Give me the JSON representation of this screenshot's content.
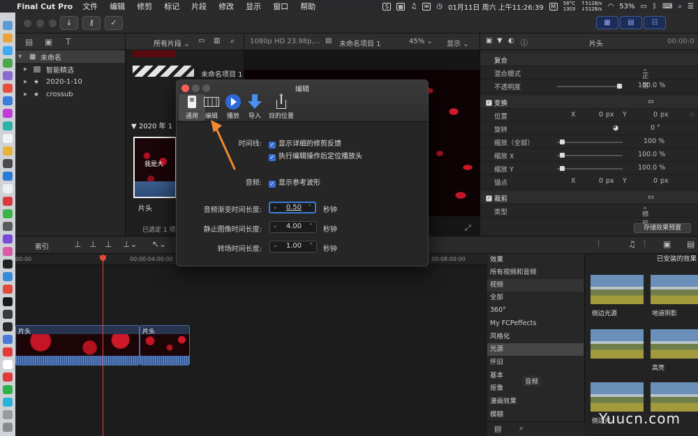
{
  "menubar": {
    "app": "Final Cut Pro",
    "items": [
      "文件",
      "编辑",
      "修剪",
      "标记",
      "片段",
      "修改",
      "显示",
      "窗口",
      "帮助"
    ],
    "temp": "58°C",
    "fan": "1303",
    "net_up": "↑512B/s",
    "net_down": "↓512B/s",
    "datetime": "01月11日 周六 上午11:26:39",
    "battery": "53%"
  },
  "library": {
    "items": [
      {
        "label": "未命名"
      },
      {
        "label": "智能精选"
      },
      {
        "label": "2020-1-10"
      },
      {
        "label": "crossub"
      }
    ]
  },
  "browser": {
    "filter": "所有片段",
    "project_name": "未命名项目 1",
    "date_group": "2020 年 1",
    "clip_name": "片头",
    "clip_overlay_text": "我是大",
    "selection_status": "已选定 1 项"
  },
  "viewer": {
    "format": "1080p HD 23.98p,...",
    "project": "未命名项目 1",
    "zoom": "45%",
    "display": "显示"
  },
  "inspector": {
    "title": "片头",
    "timecode": "00:00:0",
    "composite": {
      "section": "复合",
      "blend_label": "混合模式",
      "blend_value": "正常",
      "opacity_label": "不透明度",
      "opacity_value": "100.0 %"
    },
    "transform": {
      "section": "变换",
      "position_label": "位置",
      "x_label": "X",
      "x_value": "0",
      "px": "px",
      "y_label": "Y",
      "y_value": "0",
      "rotation_label": "旋转",
      "rotation_value": "0 °",
      "scale_all_label": "缩放（全部）",
      "scale_all_value": "100 %",
      "scale_x_label": "缩放 X",
      "scale_x_value": "100.0 %",
      "scale_y_label": "缩放 Y",
      "scale_y_value": "100.0 %",
      "anchor_label": "锚点",
      "anchor_x_value": "0",
      "anchor_y_value": "0"
    },
    "crop": {
      "section": "裁剪",
      "type_label": "类型",
      "type_value": "修剪"
    },
    "save_preset": "存储效果预置"
  },
  "timeline": {
    "index_label": "索引",
    "ruler": [
      "00:00",
      "00:00:04:00:00",
      "00:08:00:00"
    ],
    "clips": [
      {
        "label": "片头"
      },
      {
        "label": "片头"
      }
    ]
  },
  "effects": {
    "header": "效果",
    "installed_header": "已安装的效果",
    "categories": [
      "所有视频和音频",
      "视频",
      "全部",
      "360°",
      "My FCPeffects",
      "风格化",
      "光源",
      "怀旧",
      "基本",
      "抠像",
      "漫画效果",
      "模糊"
    ],
    "audio_label": "音频",
    "thumbs": [
      {
        "name": "侧边光源"
      },
      {
        "name": "地道阴影"
      },
      {
        "name": "高亮"
      },
      {
        "name": "侧边光"
      }
    ]
  },
  "dialog": {
    "title": "编辑",
    "tabs": [
      {
        "label": "通用"
      },
      {
        "label": "编辑"
      },
      {
        "label": "播放"
      },
      {
        "label": "导入"
      },
      {
        "label": "目的位置"
      }
    ],
    "timeline_label": "时间线:",
    "timeline_opt1": "显示详细的修剪反馈",
    "timeline_opt2": "执行编辑操作后定位播放头",
    "audio_label": "音频:",
    "audio_opt1": "显示参考波形",
    "audio_fade_label": "音频渐变时间长度:",
    "audio_fade_value": "0.50",
    "still_label": "静止图像时间长度:",
    "still_value": "4.00",
    "transition_label": "转场时间长度:",
    "transition_value": "1.00",
    "unit": "秒钟"
  },
  "watermark": "Yuucn.com",
  "colors": {
    "accent": "#3a6fd8",
    "arrow": "#f08a30",
    "playhead": "#e04a3a"
  }
}
